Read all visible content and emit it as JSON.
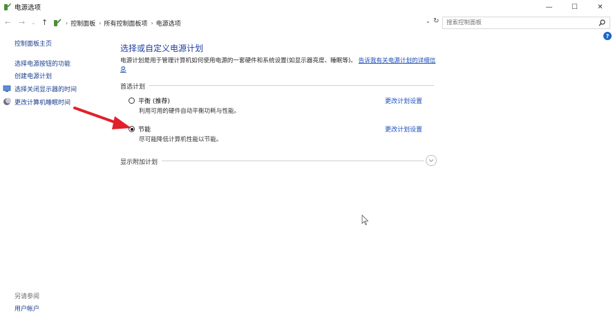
{
  "window": {
    "title": "电源选项",
    "controls": {
      "minimize": "—",
      "maximize": "☐",
      "close": "✕"
    }
  },
  "nav": {
    "back": "←",
    "forward": "→",
    "up": "↑",
    "dropdown": "⌄",
    "refresh": "↻",
    "breadcrumbs": [
      "控制面板",
      "所有控制面板项",
      "电源选项"
    ],
    "separator": "›"
  },
  "search": {
    "placeholder": "搜索控制面板"
  },
  "help": "?",
  "sidebar": {
    "home": "控制面板主页",
    "items": [
      {
        "label": "选择电源按钮的功能",
        "icon": ""
      },
      {
        "label": "创建电源计划",
        "icon": ""
      },
      {
        "label": "选择关闭显示器的时间",
        "icon": "monitor-icon"
      },
      {
        "label": "更改计算机睡眠时间",
        "icon": "moon-icon"
      }
    ],
    "see_also": "另请参阅",
    "user_accounts": "用户帐户"
  },
  "main": {
    "title": "选择或自定义电源计划",
    "description": "电源计划是用于管理计算机如何使用电源的一套硬件和系统设置(如显示器亮度、睡眠等)。",
    "description_link": "告诉我有关电源计划的详细信息",
    "preferred_label": "首选计划",
    "plans": [
      {
        "name": "平衡 (推荐)",
        "description": "利用可用的硬件自动平衡功耗与性能。",
        "selected": false,
        "change_link": "更改计划设置"
      },
      {
        "name": "节能",
        "description": "尽可能降低计算机性能以节能。",
        "selected": true,
        "change_link": "更改计划设置"
      }
    ],
    "additional_label": "显示附加计划"
  },
  "colors": {
    "link": "#1b4dbb",
    "title": "#1c3f9e",
    "annotation_arrow": "#e0202a"
  }
}
